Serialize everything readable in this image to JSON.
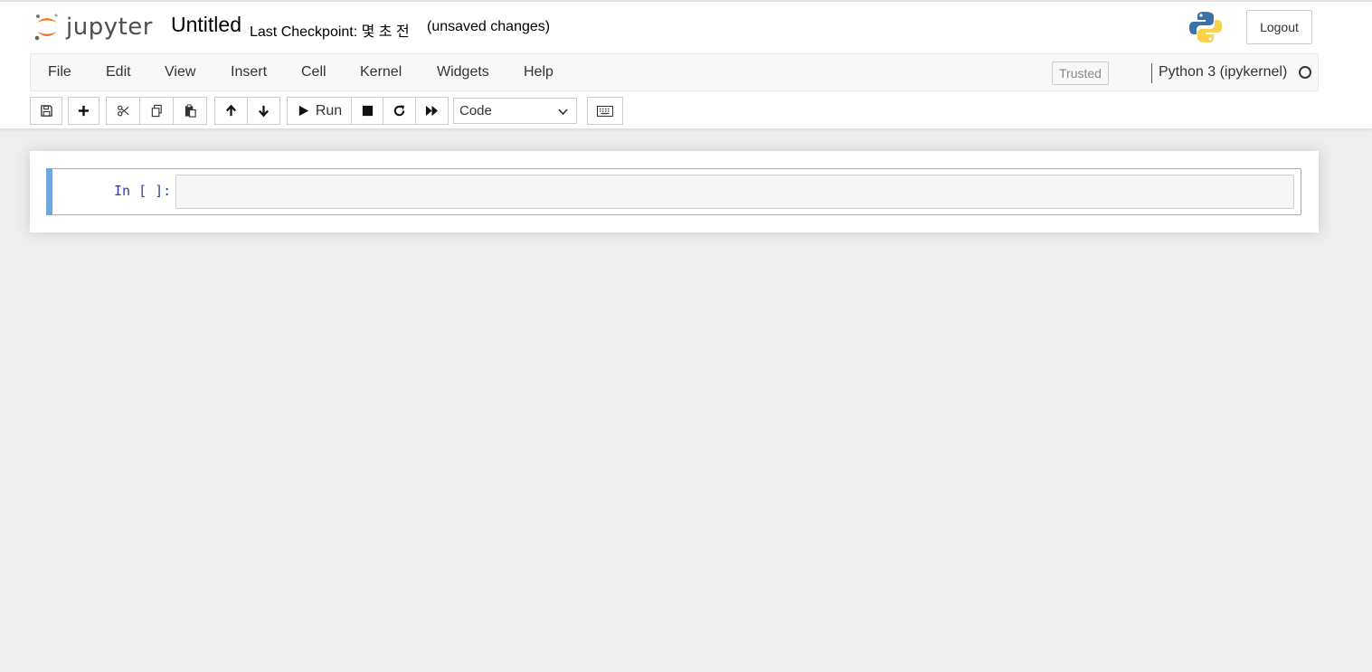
{
  "app": {
    "logo_text": "jupyter",
    "notebook_title": "Untitled",
    "checkpoint": "Last Checkpoint: 몇 초 전",
    "unsaved": "(unsaved changes)",
    "logout_label": "Logout"
  },
  "menu": {
    "items": [
      {
        "label": "File"
      },
      {
        "label": "Edit"
      },
      {
        "label": "View"
      },
      {
        "label": "Insert"
      },
      {
        "label": "Cell"
      },
      {
        "label": "Kernel"
      },
      {
        "label": "Widgets"
      },
      {
        "label": "Help"
      }
    ],
    "trusted_label": "Trusted",
    "kernel_name": "Python 3 (ipykernel)"
  },
  "toolbar": {
    "run_label": "Run",
    "cell_type": "Code",
    "icons": [
      "save-icon",
      "plus-icon",
      "cut-icon",
      "copy-icon",
      "paste-icon",
      "arrow-up-icon",
      "arrow-down-icon",
      "play-icon",
      "stop-icon",
      "restart-icon",
      "fast-forward-icon",
      "keyboard-icon"
    ]
  },
  "cells": [
    {
      "prompt": "In [ ]:",
      "source": ""
    }
  ],
  "colors": {
    "accent_cell_bar": "#66a8e8",
    "prompt_color": "#303f9f",
    "logo_orange": "#f37726"
  }
}
